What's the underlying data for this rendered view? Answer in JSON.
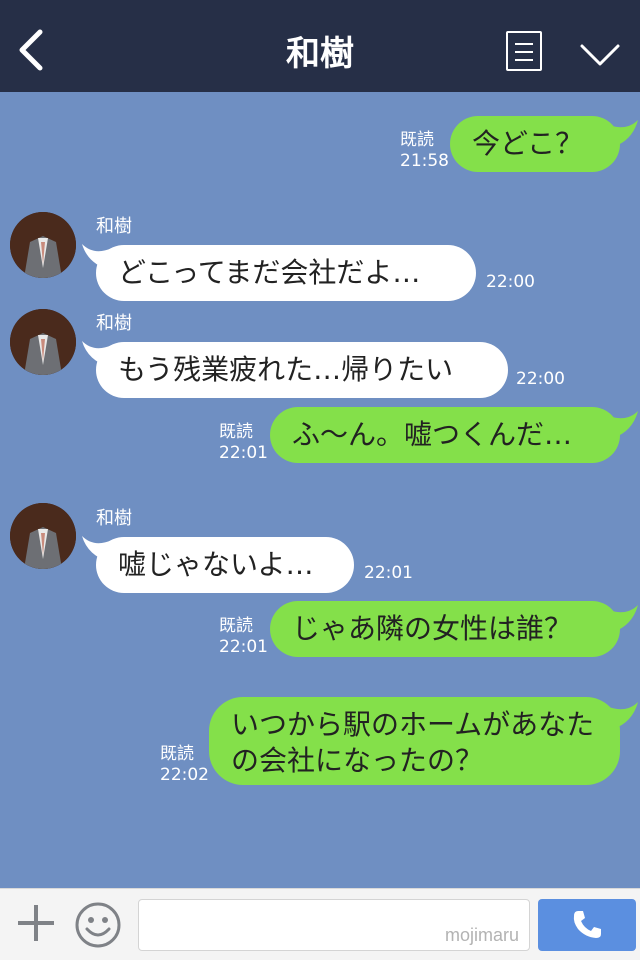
{
  "header": {
    "title": "和樹"
  },
  "messages": [
    {
      "text": "今どこ？",
      "read": "既読",
      "time": "21:58"
    },
    {
      "sender": "和樹",
      "text": "どこってまだ会社だよ…",
      "time": "22:00"
    },
    {
      "sender": "和樹",
      "text": "もう残業疲れた…帰りたい",
      "time": "22:00"
    },
    {
      "text": "ふ〜ん。嘘つくんだ…",
      "read": "既読",
      "time": "22:01"
    },
    {
      "sender": "和樹",
      "text": "嘘じゃないよ…",
      "time": "22:01"
    },
    {
      "text": "じゃあ隣の女性は誰？",
      "read": "既読",
      "time": "22:01"
    },
    {
      "text": "いつから駅のホームがあなたの会社になったの？",
      "read": "既読",
      "time": "22:02"
    }
  ],
  "composer": {
    "placeholder": "",
    "watermark": "mojimaru"
  },
  "colors": {
    "header": "#262f47",
    "background": "#6f8fc2",
    "outgoing": "#84e04a",
    "incoming": "#ffffff",
    "call": "#5b8fe0"
  },
  "icons": [
    "back-chevron-icon",
    "menu-icon",
    "chevron-down-icon",
    "plus-icon",
    "smiley-icon",
    "phone-icon"
  ]
}
